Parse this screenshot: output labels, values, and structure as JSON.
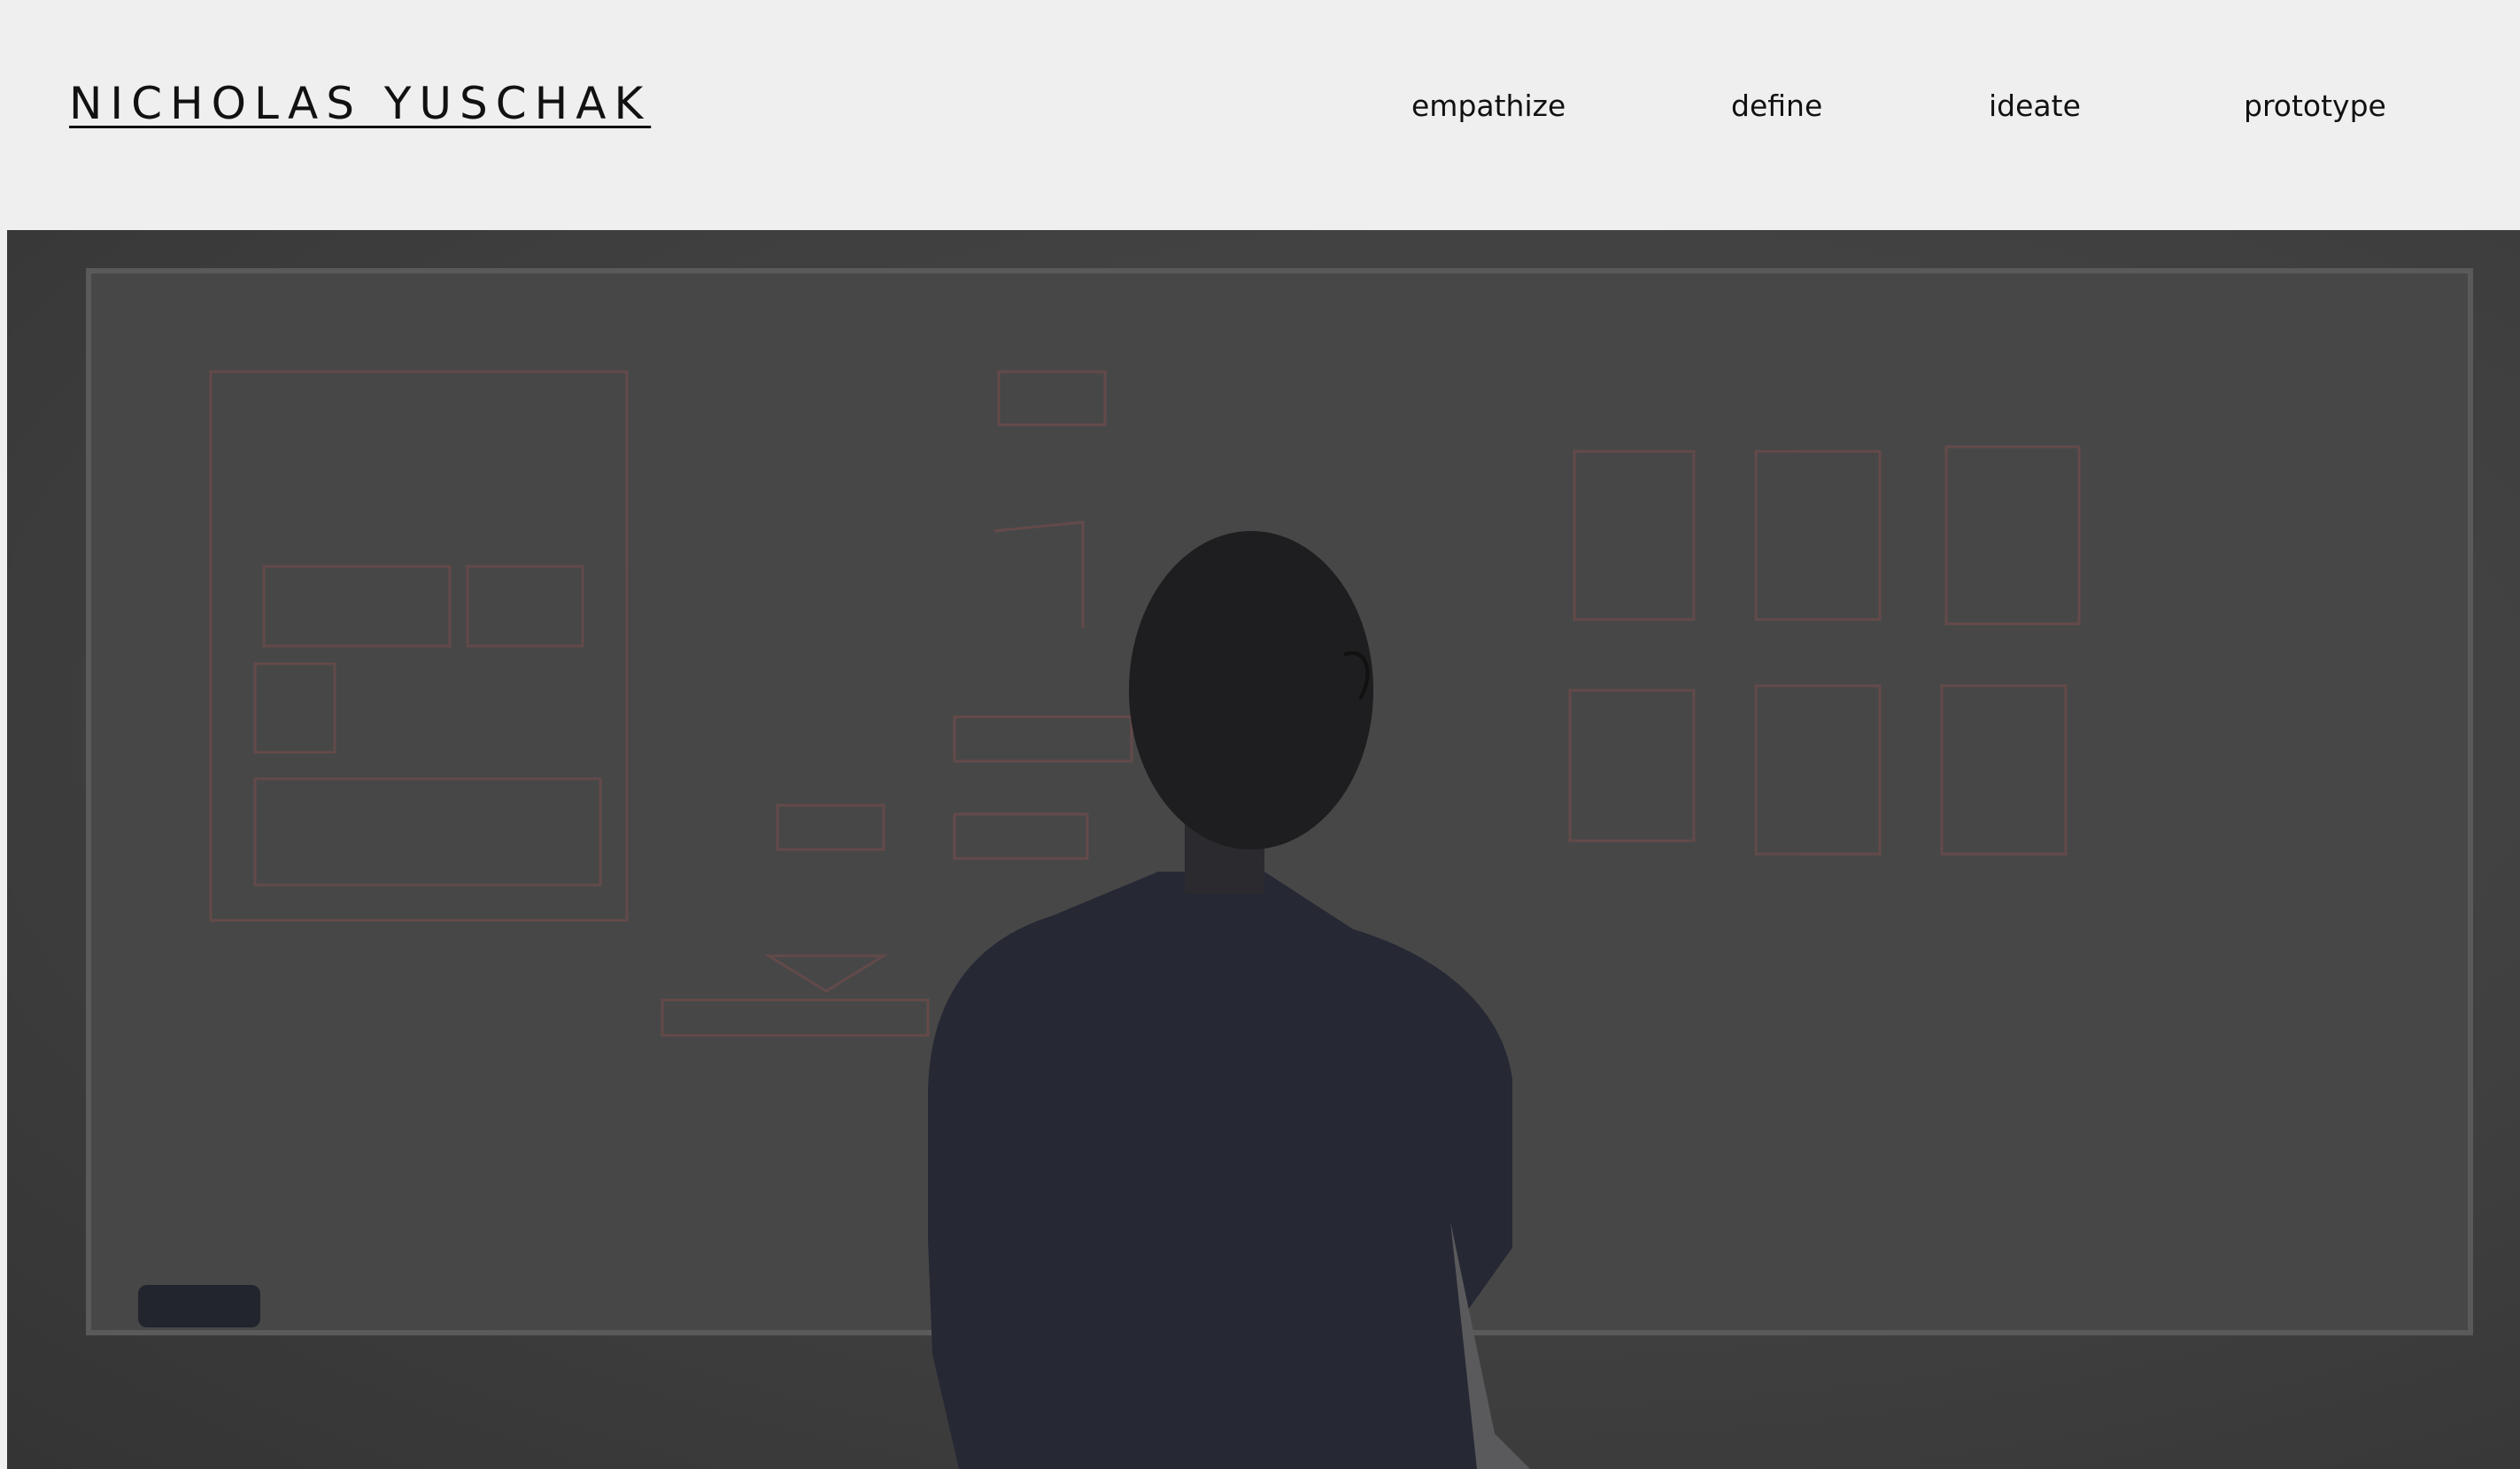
{
  "header": {
    "site_title": "NICHOLAS YUSCHAK",
    "nav": [
      {
        "label": "empathize"
      },
      {
        "label": "define"
      },
      {
        "label": "ideate"
      },
      {
        "label": "prototype"
      }
    ]
  },
  "hero": {
    "image_subject": "person-at-whiteboard-photo",
    "overlay_color": "#404040",
    "sketch_color": "#9a4a4a"
  }
}
